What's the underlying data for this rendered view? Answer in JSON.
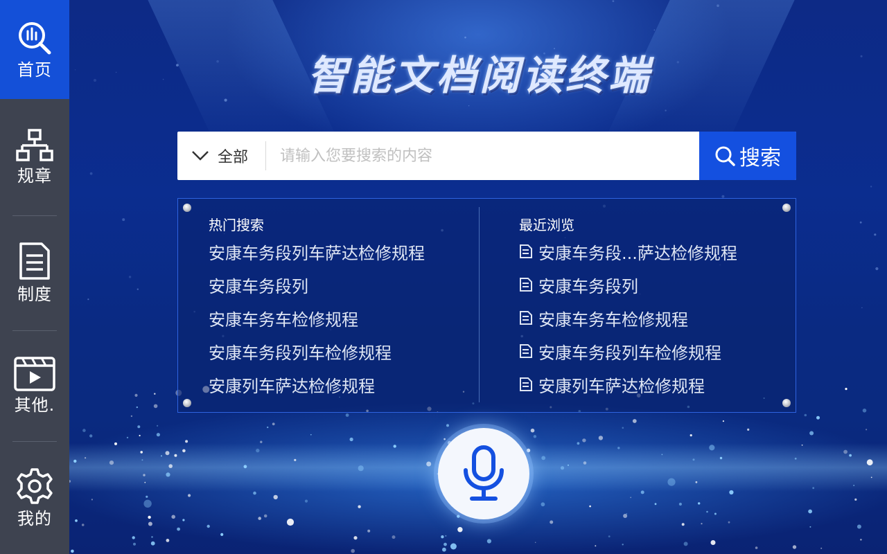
{
  "app": {
    "title": "智能文档阅读终端"
  },
  "sidebar": {
    "items": [
      {
        "label": "首页",
        "icon": "search-analytics-icon",
        "active": true
      },
      {
        "label": "规章",
        "icon": "org-chart-icon",
        "active": false
      },
      {
        "label": "制度",
        "icon": "document-icon",
        "active": false
      },
      {
        "label": "其他.",
        "icon": "video-icon",
        "active": false
      },
      {
        "label": "我的",
        "icon": "gear-icon",
        "active": false
      }
    ]
  },
  "search": {
    "scope_label": "全部",
    "placeholder": "请输入您要搜索的内容",
    "value": "",
    "button_label": "搜索"
  },
  "hot_search": {
    "title": "热门搜索",
    "items": [
      "安康车务段列车萨达检修规程",
      "安康车务段列",
      "安康车务车检修规程",
      "安康车务段列车检修规程",
      "安康列车萨达检修规程"
    ]
  },
  "recent": {
    "title": "最近浏览",
    "items": [
      "安康车务段...萨达检修规程",
      "安康车务段列",
      "安康车务车检修规程",
      "安康车务段列车检修规程",
      "安康列车萨达检修规程"
    ]
  },
  "colors": {
    "accent": "#1450e0",
    "sidebar_bg": "#3e4350",
    "sidebar_active": "#1450d8",
    "background": "#0b2d8f",
    "panel_border": "#2e63e0"
  }
}
